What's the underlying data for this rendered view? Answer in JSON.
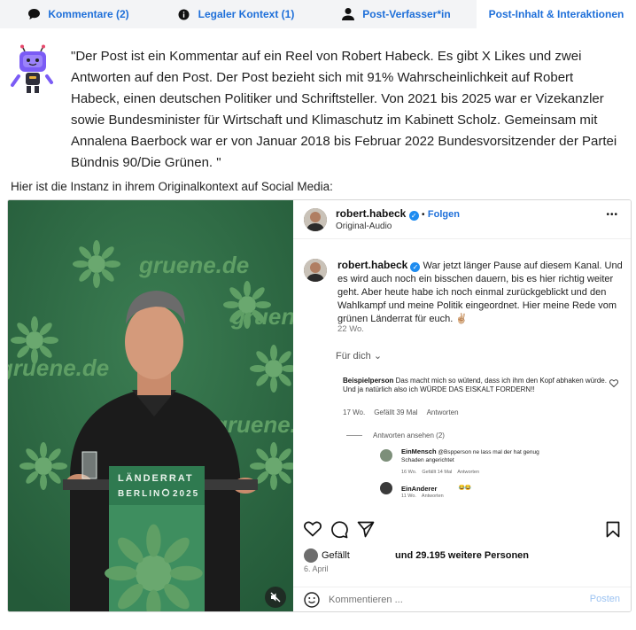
{
  "tabs": [
    {
      "label": "Kommentare (2)",
      "icon": "speech-bubble-icon"
    },
    {
      "label": "Legaler Kontext (1)",
      "icon": "info-icon"
    },
    {
      "label": "Post-Verfasser*in",
      "icon": "person-icon"
    },
    {
      "label": "Post-Inhalt & Interaktionen",
      "icon": ""
    }
  ],
  "quote": "\"Der Post ist ein Kommentar auf ein Reel von Robert Habeck. Es gibt X Likes und zwei Antworten auf den Post. Der Post bezieht sich mit 91% Wahrscheinlichkeit auf Robert Habeck, einen deutschen Politiker und Schriftsteller. Von 2021 bis 2025 war er Vizekanzler sowie Bundesminister für Wirtschaft und Klimaschutz im Kabinett Scholz. Gemeinsam mit Annalena Baerbock war er von Januar 2018 bis Februar 2022 Bundesvorsitzender der Partei Bündnis 90/Die Grünen. \"",
  "intro": "Hier ist die Instanz in ihrem Originalkontext auf Social Media:",
  "video": {
    "backdrop_text": "gruene.de",
    "lectern_line1": "LÄNDERRAT",
    "lectern_line2": "BERLIN",
    "lectern_year": "2025"
  },
  "post": {
    "username": "robert.habeck",
    "follow_label": "Folgen",
    "audio": "Original-Audio",
    "more": "•••",
    "caption": "War jetzt länger Pause auf diesem Kanal. Und es wird auch noch ein bisschen dauern, bis es hier richtig weiter geht. Aber heute habe ich noch einmal zurückgeblickt und den Wahlkampf und meine Politik eingeordnet. Hier meine Rede vom grünen Länderrat für euch. ✌🏼",
    "caption_age": "22 Wo.",
    "see_translation": "Für dich",
    "comment": {
      "author": "Beispielperson",
      "text": "Das macht mich so wütend, dass ich ihm den Kopf abhaken würde. Und ja natürlich also ich WÜRDE DAS EISKALT FORDERN!!",
      "age": "17 Wo.",
      "likes": "Gefällt 39 Mal",
      "reply_label": "Antworten"
    },
    "view_replies": "Antworten ansehen (2)",
    "replies": [
      {
        "author": "EinMensch",
        "text": "@Bspperson ne lass mal der hat genug Schaden angerichtet",
        "age": "16 Wo.",
        "likes": "Gefällt 14 Mal",
        "reply_label": "Antworten"
      },
      {
        "author": "EinAnderer",
        "text": "😂😂",
        "age": "11 Wo.",
        "likes": "",
        "reply_label": "Antworten"
      }
    ],
    "liked_by": "Gefällt",
    "likes_rest": "und 29.195 weitere Personen",
    "date": "6. April",
    "comment_placeholder": "Kommentieren ...",
    "post_button": "Posten"
  },
  "colors": {
    "accent": "#1e6fd9",
    "tab_bg": "#f3f4f6",
    "video_green": "#2f6b46",
    "bot_purple": "#7b5cf5"
  }
}
